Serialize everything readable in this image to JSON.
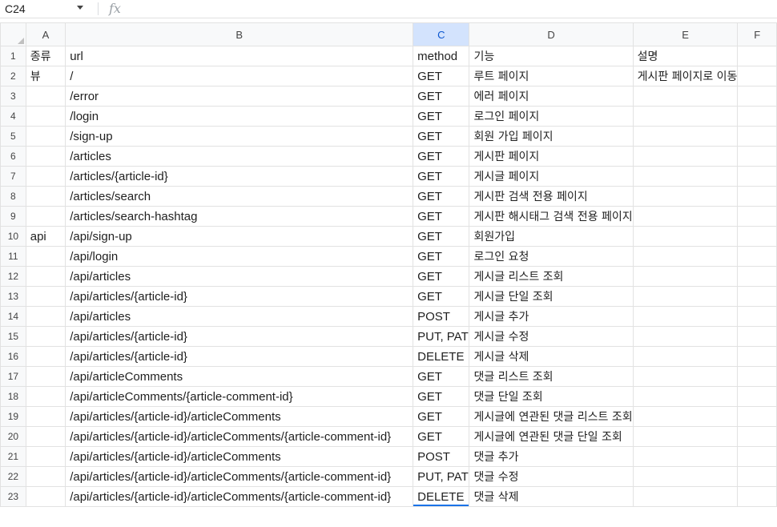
{
  "formula_bar": {
    "cell_ref": "C24",
    "fx_label": "fx",
    "formula": ""
  },
  "columns": [
    "A",
    "B",
    "C",
    "D",
    "E",
    "F"
  ],
  "active_column": "C",
  "active_cell": "C24",
  "rows": [
    {
      "n": "1",
      "a": "종류",
      "b": "url",
      "c": "method",
      "d": "기능",
      "e": "설명"
    },
    {
      "n": "2",
      "a": "뷰",
      "b": "/",
      "c": "GET",
      "d": "루트 페이지",
      "e": "게시판 페이지로 이동"
    },
    {
      "n": "3",
      "a": "",
      "b": "/error",
      "c": "GET",
      "d": "에러 페이지",
      "e": ""
    },
    {
      "n": "4",
      "a": "",
      "b": "/login",
      "c": "GET",
      "d": "로그인 페이지",
      "e": ""
    },
    {
      "n": "5",
      "a": "",
      "b": "/sign-up",
      "c": "GET",
      "d": "회원 가입 페이지",
      "e": ""
    },
    {
      "n": "6",
      "a": "",
      "b": "/articles",
      "c": "GET",
      "d": "게시판 페이지",
      "e": ""
    },
    {
      "n": "7",
      "a": "",
      "b": "/articles/{article-id}",
      "c": "GET",
      "d": "게시글 페이지",
      "e": ""
    },
    {
      "n": "8",
      "a": "",
      "b": "/articles/search",
      "c": "GET",
      "d": "게시판 검색 전용 페이지",
      "e": ""
    },
    {
      "n": "9",
      "a": "",
      "b": "/articles/search-hashtag",
      "c": "GET",
      "d": "게시판 해시태그 검색 전용 페이지",
      "e": ""
    },
    {
      "n": "10",
      "a": "api",
      "b": "/api/sign-up",
      "c": "GET",
      "d": "회원가입",
      "e": ""
    },
    {
      "n": "11",
      "a": "",
      "b": "/api/login",
      "c": "GET",
      "d": "로그인 요청",
      "e": ""
    },
    {
      "n": "12",
      "a": "",
      "b": "/api/articles",
      "c": "GET",
      "d": "게시글 리스트 조회",
      "e": ""
    },
    {
      "n": "13",
      "a": "",
      "b": "/api/articles/{article-id}",
      "c": "GET",
      "d": "게시글 단일 조회",
      "e": ""
    },
    {
      "n": "14",
      "a": "",
      "b": "/api/articles",
      "c": "POST",
      "d": "게시글 추가",
      "e": ""
    },
    {
      "n": "15",
      "a": "",
      "b": "/api/articles/{article-id}",
      "c": "PUT, PAT",
      "d": "게시글 수정",
      "e": ""
    },
    {
      "n": "16",
      "a": "",
      "b": "/api/articles/{article-id}",
      "c": "DELETE",
      "d": "게시글 삭제",
      "e": ""
    },
    {
      "n": "17",
      "a": "",
      "b": "/api/articleComments",
      "c": "GET",
      "d": "댓글 리스트 조회",
      "e": ""
    },
    {
      "n": "18",
      "a": "",
      "b": "/api/articleComments/{article-comment-id}",
      "c": "GET",
      "d": "댓글 단일 조회",
      "e": ""
    },
    {
      "n": "19",
      "a": "",
      "b": "/api/articles/{article-id}/articleComments",
      "c": "GET",
      "d": "게시글에 연관된 댓글 리스트 조회",
      "e": ""
    },
    {
      "n": "20",
      "a": "",
      "b": "/api/articles/{article-id}/articleComments/{article-comment-id}",
      "c": "GET",
      "d": "게시글에 연관된 댓글 단일 조회",
      "e": ""
    },
    {
      "n": "21",
      "a": "",
      "b": "/api/articles/{article-id}/articleComments",
      "c": "POST",
      "d": "댓글 추가",
      "e": ""
    },
    {
      "n": "22",
      "a": "",
      "b": "/api/articles/{article-id}/articleComments/{article-comment-id}",
      "c": "PUT, PAT",
      "d": "댓글 수정",
      "e": ""
    },
    {
      "n": "23",
      "a": "",
      "b": "/api/articles/{article-id}/articleComments/{article-comment-id}",
      "c": "DELETE",
      "d": "댓글 삭제",
      "e": ""
    }
  ]
}
